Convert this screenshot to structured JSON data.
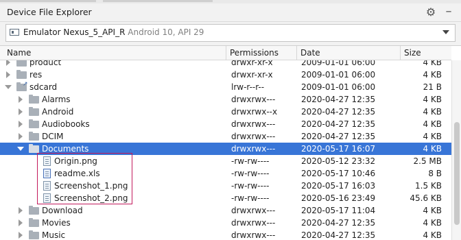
{
  "panel": {
    "title": "Device File Explorer",
    "gear_icon": "gear-icon",
    "minimize_icon": "minimize-icon"
  },
  "device": {
    "name": "Emulator Nexus_5_API_R",
    "detail": "Android 10, API 29"
  },
  "columns": {
    "name": "Name",
    "permissions": "Permissions",
    "date": "Date",
    "size": "Size"
  },
  "rows": [
    {
      "name": "product",
      "perm": "drwxr-xr-x",
      "date": "2009-01-01 06:00",
      "size": "4 KB"
    },
    {
      "name": "res",
      "perm": "drwxr-xr-x",
      "date": "2009-01-01 06:00",
      "size": "4 KB"
    },
    {
      "name": "sdcard",
      "perm": "lrw-r--r--",
      "date": "2009-01-01 06:00",
      "size": "21 B"
    },
    {
      "name": "Alarms",
      "perm": "drwxrwx---",
      "date": "2020-04-27 12:35",
      "size": "4 KB"
    },
    {
      "name": "Android",
      "perm": "drwxrwx--x",
      "date": "2020-04-27 12:35",
      "size": "4 KB"
    },
    {
      "name": "Audiobooks",
      "perm": "drwxrwx---",
      "date": "2020-04-27 12:35",
      "size": "4 KB"
    },
    {
      "name": "DCIM",
      "perm": "drwxrwx---",
      "date": "2020-04-27 12:35",
      "size": "4 KB"
    },
    {
      "name": "Documents",
      "perm": "drwxrwx---",
      "date": "2020-05-17 16:07",
      "size": "4 KB"
    },
    {
      "name": "Origin.png",
      "perm": "-rw-rw----",
      "date": "2020-05-12 23:32",
      "size": "2.5 MB"
    },
    {
      "name": "readme.xls",
      "perm": "-rw-rw----",
      "date": "2020-05-17 10:46",
      "size": "8 B"
    },
    {
      "name": "Screenshot_1.png",
      "perm": "-rw-rw----",
      "date": "2020-05-17 16:03",
      "size": "1.5 KB"
    },
    {
      "name": "Screenshot_2.png",
      "perm": "-rw-rw----",
      "date": "2020-05-16 23:49",
      "size": "45.6 KB"
    },
    {
      "name": "Download",
      "perm": "drwxrwx---",
      "date": "2020-05-17 11:04",
      "size": "4 KB"
    },
    {
      "name": "Movies",
      "perm": "drwxrwx---",
      "date": "2020-04-27 12:35",
      "size": "4 KB"
    },
    {
      "name": "Music",
      "perm": "drwxrwx---",
      "date": "2020-04-27 12:35",
      "size": "4 KB"
    }
  ],
  "colors": {
    "selection": "#3875d7",
    "highlight_box": "#c2185b"
  }
}
